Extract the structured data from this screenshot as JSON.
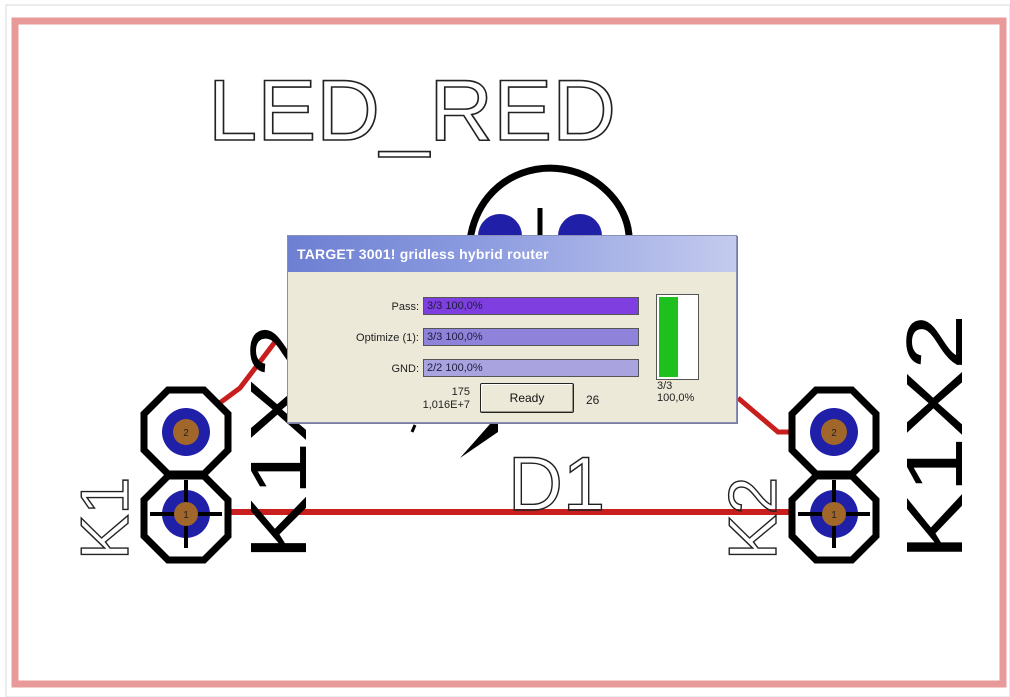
{
  "board": {
    "value_label": "LED_RED",
    "designator": "D1",
    "pad_labels": {
      "left_top": "K1X2",
      "left_bottom": "K1",
      "right_bottom": "K2",
      "right_top": "K1X2"
    },
    "pins": {
      "top": "2",
      "bottom": "1"
    }
  },
  "dialog": {
    "title": "TARGET 3001! gridless hybrid router",
    "rows": [
      {
        "label": "Pass:",
        "value": "3/3 100,0%",
        "fraction": 1.0,
        "fill_color": "#7f3fe0"
      },
      {
        "label": "Optimize (1):",
        "value": "3/3 100,0%",
        "fraction": 1.0,
        "fill_color": "#8f82da"
      },
      {
        "label": "GND:",
        "value": "2/2 100,0%",
        "fraction": 1.0,
        "fill_color": "#a9a3e0"
      }
    ],
    "stats_line1": "175",
    "stats_line2": "1,016E+7",
    "ready_button": "Ready",
    "count_right": "26",
    "meter": {
      "count": "3/3",
      "percent": "100,0%",
      "fraction": 0.5
    }
  },
  "colors": {
    "frame": "#e89a9a",
    "track": "#c81e1e",
    "pad_ring": "#1f1fa8",
    "pad_drill": "#a0662a",
    "accent_green": "#1ec01e"
  }
}
